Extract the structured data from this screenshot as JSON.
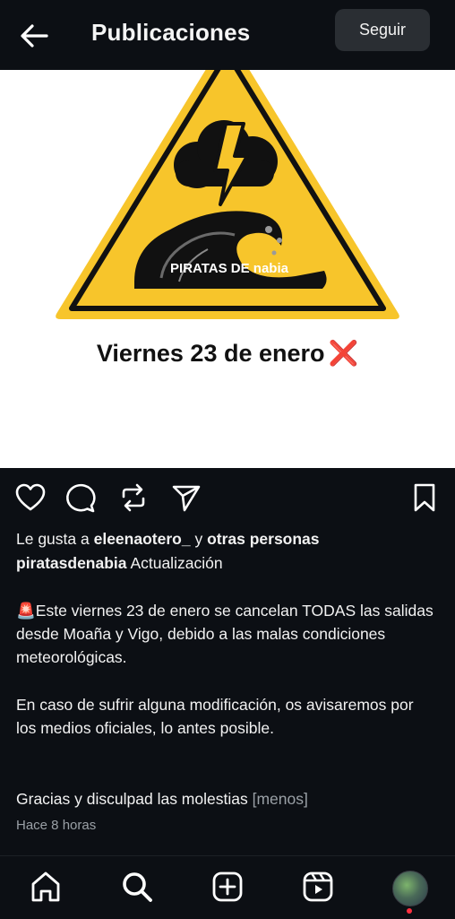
{
  "header": {
    "title": "Publicaciones",
    "follow_label": "Seguir",
    "back_icon": "arrow-left-icon"
  },
  "post": {
    "image_logo_text": "PIRATAS DE nabia",
    "image_text": "Viernes 23 de enero",
    "image_text_mark": "❌",
    "colors": {
      "warning_yellow": "#f7c52b",
      "black": "#111111",
      "red_x": "#e0232a"
    }
  },
  "actions": {
    "like_icon": "heart-icon",
    "comment_icon": "comment-icon",
    "repost_icon": "repost-icon",
    "share_icon": "send-icon",
    "save_icon": "bookmark-icon"
  },
  "likes": {
    "prefix": "Le gusta a ",
    "user": "eleenaotero_",
    "joiner": " y ",
    "others": "otras personas"
  },
  "caption": {
    "username": "piratasdenabia",
    "title": "Actualización",
    "line1_emoji": "🚨",
    "paragraph1": "Este viernes 23 de enero se cancelan TODAS las salidas desde Moaña y Vigo, debido a las malas condiciones meteorológicas.",
    "paragraph2": "En caso de sufrir alguna modificación, os avisaremos por los medios oficiales, lo antes posible.",
    "paragraph3": "Gracias y disculpad las molestias",
    "less_label": "[menos]"
  },
  "timestamp": "Hace 8 horas",
  "bottom_nav": {
    "items": [
      "home-icon",
      "search-icon",
      "create-icon",
      "reels-icon",
      "profile-avatar"
    ]
  }
}
